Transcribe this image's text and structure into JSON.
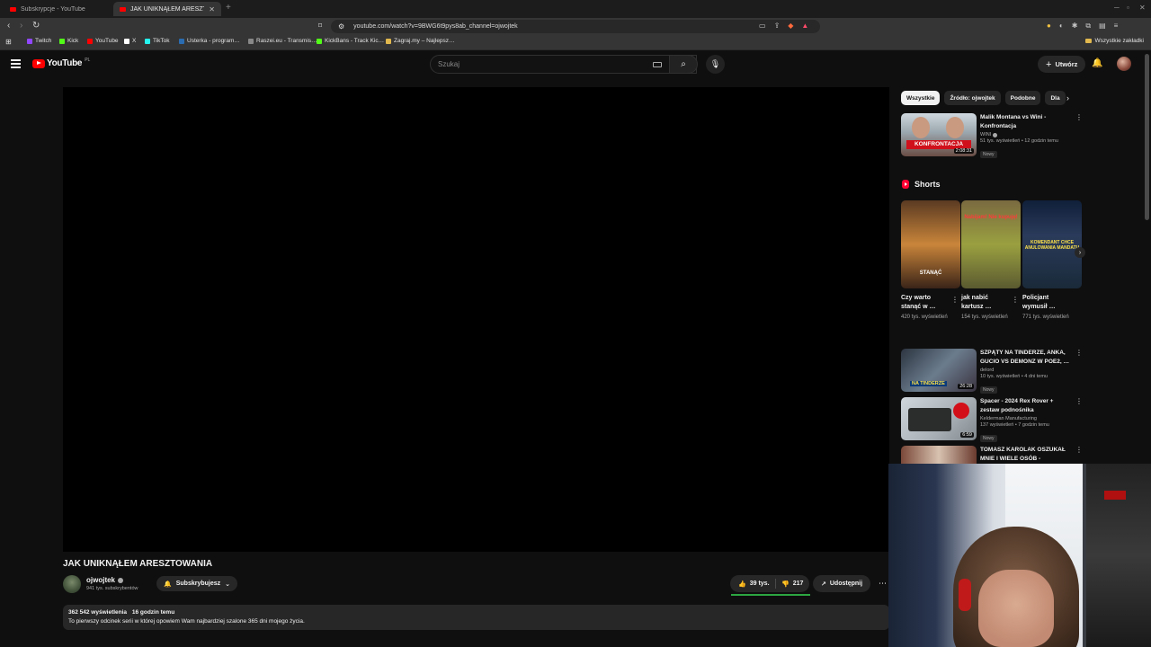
{
  "browser": {
    "tabs": [
      {
        "title": "Subskrypcje - YouTube",
        "active": false
      },
      {
        "title": "JAK UNIKNĄŁEM ARESZTOWA…",
        "active": true
      }
    ],
    "url": "youtube.com/watch?v=9BWG6t9pys8ab_channel=ojwojtek",
    "bookmarks": [
      {
        "label": "Twitch",
        "color": "#9146ff"
      },
      {
        "label": "Kick",
        "color": "#53fc18"
      },
      {
        "label": "YouTube",
        "color": "#ff0000"
      },
      {
        "label": "X",
        "color": "#ffffff"
      },
      {
        "label": "TikTok",
        "color": "#25f4ee"
      },
      {
        "label": "Usterka - program…",
        "color": "#2b6cb0"
      },
      {
        "label": "Raszei.eu - Transmis…",
        "color": "#888888"
      },
      {
        "label": "KickBans - Track Kic…",
        "color": "#53fc18"
      },
      {
        "label": "Zagraj.my – Najlepsz…",
        "color": "#e0b84d"
      }
    ],
    "all_bookmarks": "Wszystkie zakładki"
  },
  "masthead": {
    "logo_text": "YouTube",
    "country": "PL",
    "search_placeholder": "Szukaj",
    "create_label": "Utwórz"
  },
  "video": {
    "title": "JAK UNIKNĄŁEM ARESZTOWANIA",
    "channel": "ojwojtek",
    "subscribers": "941 tys. subskrybentów",
    "subscribe_label": "Subskrybujesz",
    "likes": "39 tys.",
    "dislikes": "217",
    "like_ratio": 0.995,
    "share_label": "Udostępnij",
    "views": "362 542 wyświetlenia",
    "published": "16 godzin temu",
    "description": "To pierwszy odcinek serii w której opowiem Wam najbardziej szalone 365 dni mojego życia."
  },
  "chips": [
    "Wszystkie",
    "Źródło: ojwojtek",
    "Podobne",
    "Dla"
  ],
  "recommendations": [
    {
      "title": "Malik Montana vs Wini - Konfrontacja",
      "channel": "WINI",
      "verified": true,
      "stats": "51 tys. wyświetleń • 12 godzin temu",
      "badge": "Nowy",
      "duration": "2:08:31",
      "thumb_text": "KONFRONTACJA"
    },
    {
      "title": "SZPĄTY NA TINDERZE, ANKA, GUCIO VS DEMONZ W POE2, …",
      "channel": "delord",
      "verified": false,
      "stats": "10 tys. wyświetleń • 4 dni temu",
      "badge": "Nowy",
      "duration": "26:28",
      "thumb_text": "NA TINDERZE"
    },
    {
      "title": "Spacer - 2024 Rex Rover + zestaw podnośnika Kelderman…",
      "channel": "Kelderman Manufacturing",
      "verified": false,
      "stats": "137 wyświetleń • 7 godzin temu",
      "badge": "Nowy",
      "duration": "6:59",
      "thumb_text": ""
    },
    {
      "title": "TOMASZ KAROLAK OSZUKAŁ MNIE I WIELE OSÓB - ROBERT…",
      "channel": "",
      "verified": false,
      "stats": "",
      "badge": "",
      "duration": "",
      "thumb_text": ""
    }
  ],
  "shorts": {
    "heading": "Shorts",
    "items": [
      {
        "title": "Czy warto stanąć w …",
        "views": "420 tys. wyświetleń",
        "overlay": "STANĄĆ"
      },
      {
        "title": "jak nabić kartusz …",
        "views": "154 tys. wyświetleń",
        "overlay": "Nabijam! Nie kupuję!"
      },
      {
        "title": "Policjant wymusił …",
        "views": "771 tys. wyświetleń",
        "overlay": "KOMENDANT CHCE ANULOWANIA MANDATU"
      }
    ]
  }
}
